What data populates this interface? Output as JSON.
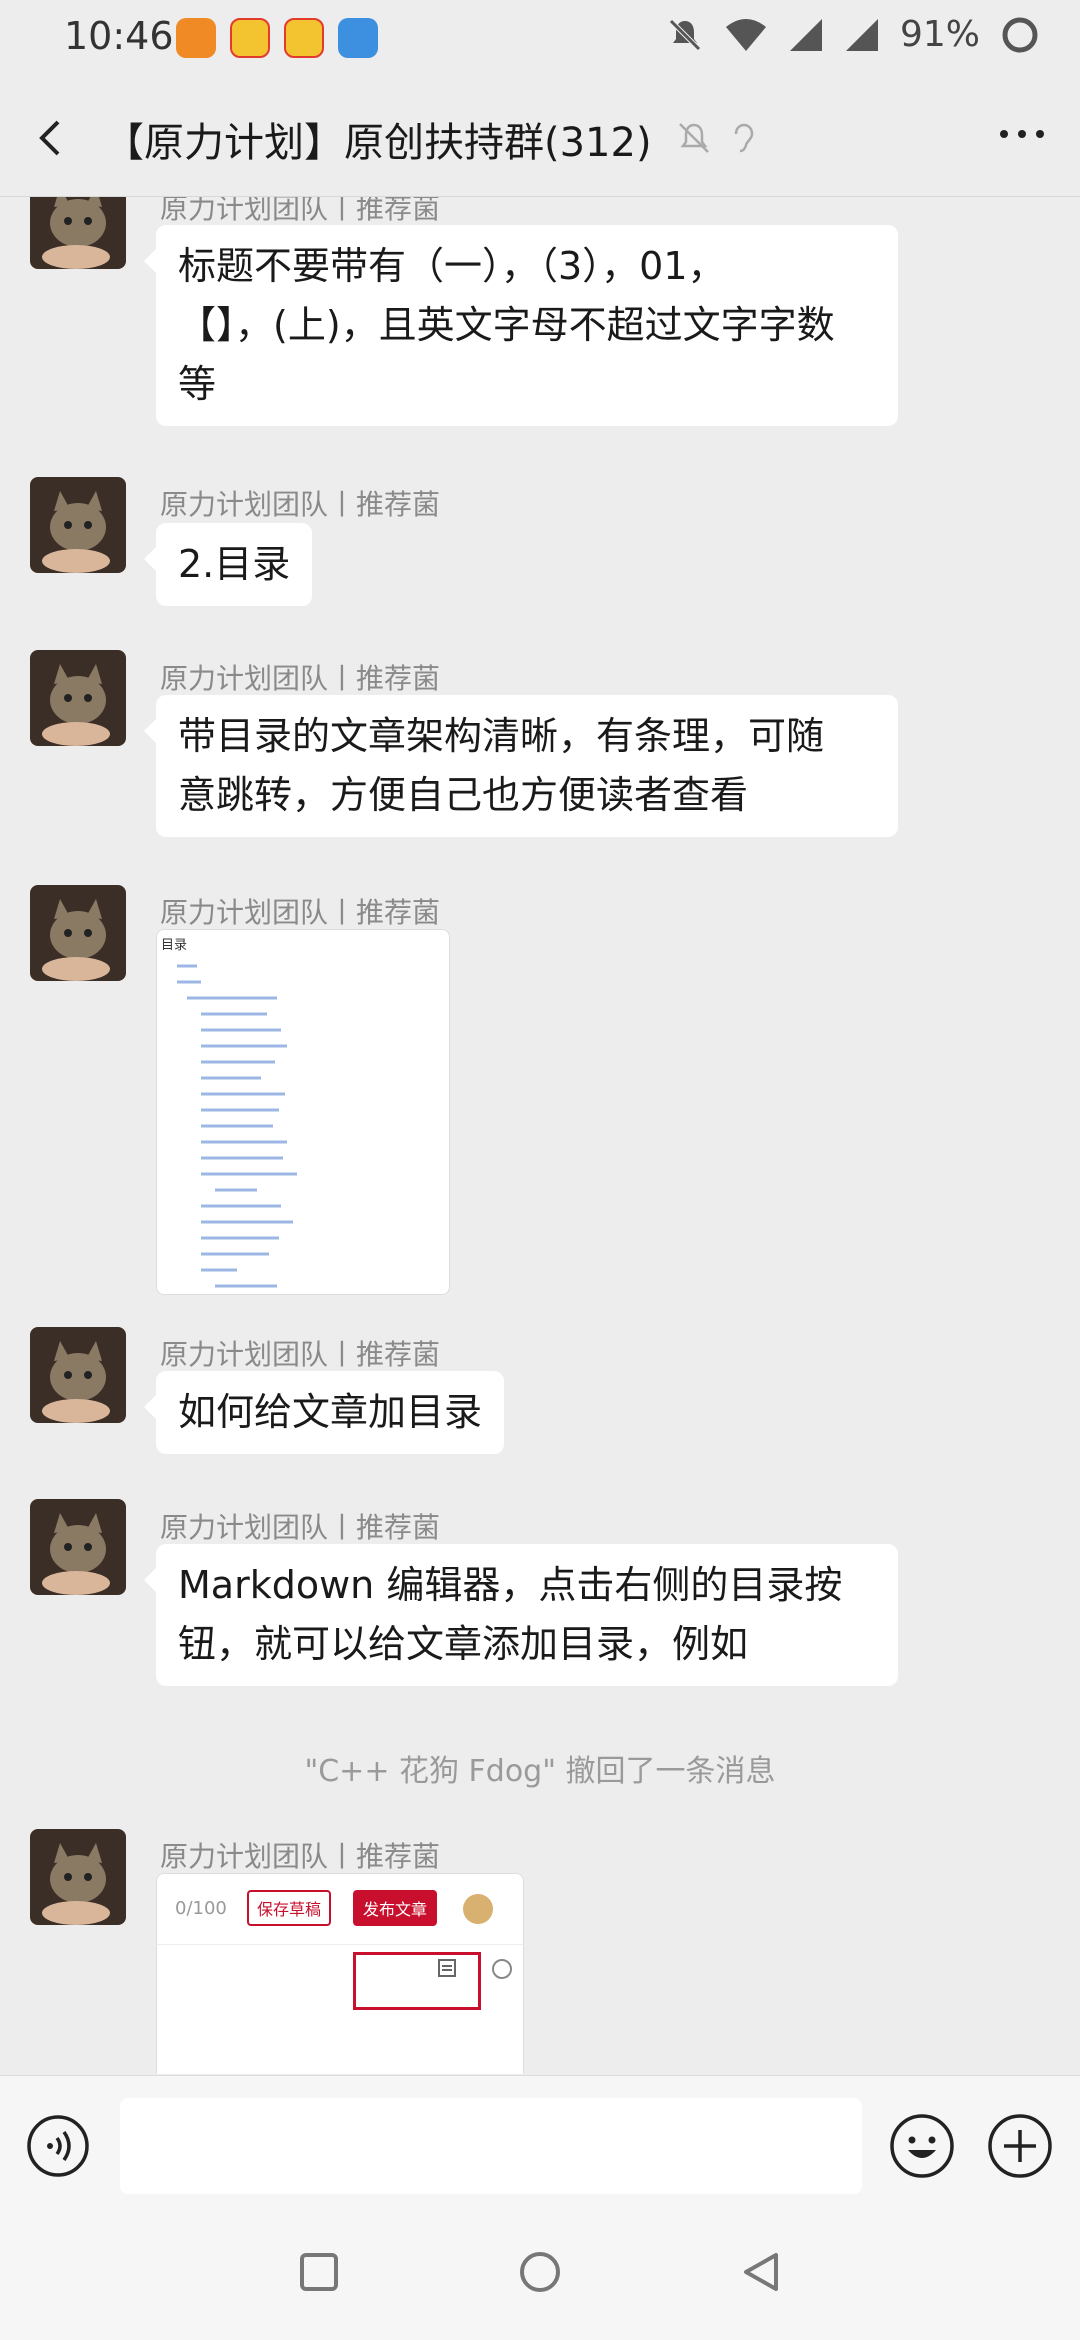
{
  "status_bar": {
    "time": "10:46",
    "battery": "91%"
  },
  "header": {
    "title": "【原力计划】原创扶持群(312)"
  },
  "messages": [
    {
      "sender": "原力计划团队丨推荐菌",
      "lines": [
        "标题不要带有（一），（3），01，",
        "【】，(上)，且英文字母不超过文字字数",
        "等"
      ]
    },
    {
      "sender": "原力计划团队丨推荐菌",
      "lines": [
        "2.目录"
      ]
    },
    {
      "sender": "原力计划团队丨推荐菌",
      "lines": [
        "带目录的文章架构清晰，有条理，可随",
        "意跳转，方便自己也方便读者查看"
      ]
    },
    {
      "sender": "原力计划团队丨推荐菌",
      "image_title": "目录"
    },
    {
      "sender": "原力计划团队丨推荐菌",
      "lines": [
        "如何给文章加目录"
      ]
    },
    {
      "sender": "原力计划团队丨推荐菌",
      "lines": [
        "Markdown 编辑器，点击右侧的目录按",
        "钮，就可以给文章添加目录，例如"
      ]
    },
    {
      "notice": "\"C++ 花狗 Fdog\" 撤回了一条消息"
    },
    {
      "sender": "原力计划团队丨推荐菌",
      "image_title": "",
      "screenshot_buttons": [
        "0/100",
        "保存草稿",
        "发布文章"
      ]
    }
  ],
  "input_bar": {
    "placeholder": ""
  },
  "icons": [
    "back-icon",
    "mute-icon",
    "ear-icon",
    "more-icon",
    "voice-icon",
    "emoji-icon",
    "plus-icon",
    "recent-apps-icon",
    "home-icon",
    "back-nav-icon"
  ]
}
